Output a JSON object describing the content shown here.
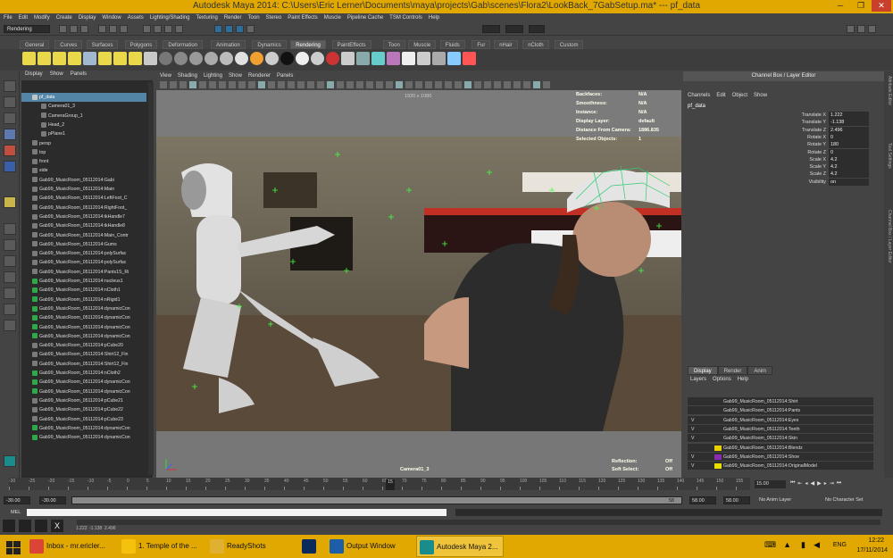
{
  "window": {
    "title": "Autodesk Maya 2014: C:\\Users\\Eric Lerner\\Documents\\maya\\projects\\Gab\\scenes\\Flora2\\LookBack_7GabSetup.ma*   ---   pf_data",
    "minimize": "─",
    "maximize": "❐",
    "close": "✕"
  },
  "menu": [
    "File",
    "Edit",
    "Modify",
    "Create",
    "Display",
    "Window",
    "Assets",
    "Lighting/Shading",
    "Texturing",
    "Render",
    "Toon",
    "Stereo",
    "Paint Effects",
    "Muscle",
    "Pipeline Cache",
    "TSM Controls",
    "Help"
  ],
  "status": {
    "menuset": "Rendering"
  },
  "shelf_tabs": [
    {
      "label": "General",
      "active": false
    },
    {
      "label": "Curves",
      "active": false
    },
    {
      "label": "Surfaces",
      "active": false
    },
    {
      "label": "Polygons",
      "active": false
    },
    {
      "label": "Deformation",
      "active": false
    },
    {
      "label": "Animation",
      "active": false
    },
    {
      "label": "Dynamics",
      "active": false
    },
    {
      "label": "Rendering",
      "active": true
    },
    {
      "label": "PaintEffects",
      "active": false
    },
    {
      "label": "Toon",
      "active": false
    },
    {
      "label": "Muscle",
      "active": false
    },
    {
      "label": "Fluids",
      "active": false
    },
    {
      "label": "Fur",
      "active": false
    },
    {
      "label": "nHair",
      "active": false
    },
    {
      "label": "nCloth",
      "active": false
    },
    {
      "label": "Custom",
      "active": false
    }
  ],
  "outliner": {
    "menu": [
      "Display",
      "Show",
      "Panels"
    ],
    "items": [
      {
        "label": "pf_data",
        "sel": true,
        "indent": 1,
        "icon": "j"
      },
      {
        "label": "Camera01_3",
        "indent": 2,
        "icon": "c"
      },
      {
        "label": "CameraGroup_1",
        "indent": 2,
        "icon": "c"
      },
      {
        "label": "Head_2",
        "indent": 2,
        "icon": "c"
      },
      {
        "label": "pPlane1",
        "indent": 2,
        "icon": "c"
      },
      {
        "label": "persp",
        "indent": 1,
        "icon": "c"
      },
      {
        "label": "top",
        "indent": 1,
        "icon": "c"
      },
      {
        "label": "front",
        "indent": 1,
        "icon": "c"
      },
      {
        "label": "side",
        "indent": 1,
        "icon": "c"
      },
      {
        "label": "Gab99_MusicRoom_0511201​4:Gabi",
        "indent": 1,
        "icon": "c"
      },
      {
        "label": "Gab99_MusicRoom_0511201​4:Main",
        "indent": 1,
        "icon": "c"
      },
      {
        "label": "Gab99_MusicRoom_0511201​4:LeftFoot_C",
        "indent": 1,
        "icon": "c"
      },
      {
        "label": "Gab99_MusicRoom_0511201​4:RightFoot_",
        "indent": 1,
        "icon": "c"
      },
      {
        "label": "Gab99_MusicRoom_0511201​4:ikHandle7",
        "indent": 1,
        "icon": "c"
      },
      {
        "label": "Gab99_MusicRoom_0511201​4:ikHandle8",
        "indent": 1,
        "icon": "c"
      },
      {
        "label": "Gab99_MusicRoom_0511201​4:Main_Contr",
        "indent": 1,
        "icon": "c"
      },
      {
        "label": "Gab99_MusicRoom_0511201​4:Gums",
        "indent": 1,
        "icon": "c"
      },
      {
        "label": "Gab99_MusicRoom_0511201​4:polySurfac",
        "indent": 1,
        "icon": "c"
      },
      {
        "label": "Gab99_MusicRoom_0511201​4:polySurfac",
        "indent": 1,
        "icon": "c"
      },
      {
        "label": "Gab99_MusicRoom_0511201​4:Pants1S_Ri",
        "indent": 1,
        "icon": "c"
      },
      {
        "label": "Gab99_MusicRoom_0511201​4:nucleus1",
        "indent": 1,
        "icon": "g"
      },
      {
        "label": "Gab99_MusicRoom_0511201​4:nCloth1",
        "indent": 1,
        "icon": "g"
      },
      {
        "label": "Gab99_MusicRoom_0511201​4:nRigid1",
        "indent": 1,
        "icon": "g"
      },
      {
        "label": "Gab99_MusicRoom_0511201​4:dynamicCon",
        "indent": 1,
        "icon": "g"
      },
      {
        "label": "Gab99_MusicRoom_0511201​4:dynamicCon",
        "indent": 1,
        "icon": "g"
      },
      {
        "label": "Gab99_MusicRoom_0511201​4:dynamicCon",
        "indent": 1,
        "icon": "g"
      },
      {
        "label": "Gab99_MusicRoom_0511201​4:dynamicCon",
        "indent": 1,
        "icon": "g"
      },
      {
        "label": "Gab99_MusicRoom_0511201​4:pCube20",
        "indent": 1,
        "icon": "c"
      },
      {
        "label": "Gab99_MusicRoom_0511201​4:Shirt12_Fin",
        "indent": 1,
        "icon": "c"
      },
      {
        "label": "Gab99_MusicRoom_0511201​4:Shirt12_Fin",
        "indent": 1,
        "icon": "c"
      },
      {
        "label": "Gab99_MusicRoom_0511201​4:nCloth2",
        "indent": 1,
        "icon": "g"
      },
      {
        "label": "Gab99_MusicRoom_0511201​4:dynamicCon",
        "indent": 1,
        "icon": "g"
      },
      {
        "label": "Gab99_MusicRoom_0511201​4:dynamicCon",
        "indent": 1,
        "icon": "g"
      },
      {
        "label": "Gab99_MusicRoom_0511201​4:pCube21",
        "indent": 1,
        "icon": "c"
      },
      {
        "label": "Gab99_MusicRoom_0511201​4:pCube22",
        "indent": 1,
        "icon": "c"
      },
      {
        "label": "Gab99_MusicRoom_0511201​4:pCube23",
        "indent": 1,
        "icon": "c"
      },
      {
        "label": "Gab99_MusicRoom_0511201​4:dynamicCon",
        "indent": 1,
        "icon": "g"
      },
      {
        "label": "Gab99_MusicRoom_0511201​4:dynamicCon",
        "indent": 1,
        "icon": "g"
      }
    ]
  },
  "viewport": {
    "menu": [
      "View",
      "Shading",
      "Lighting",
      "Show",
      "Renderer",
      "Panels"
    ],
    "resolution": "1920 x 1080",
    "hud": [
      {
        "k": "Backfaces:",
        "v": "N/A"
      },
      {
        "k": "Smoothness:",
        "v": "N/A"
      },
      {
        "k": "Instance:",
        "v": "N/A"
      },
      {
        "k": "Display Layer:",
        "v": "default"
      },
      {
        "k": "Distance From Camera:",
        "v": "1886.835"
      },
      {
        "k": "Selected Objects:",
        "v": "1"
      }
    ],
    "camera": "Camera01_3",
    "reflection_label": "Reflection:",
    "reflection": "Off",
    "softselect_label": "Soft Select:",
    "softselect": "Off"
  },
  "channelbox": {
    "title": "Channel Box / Layer Editor",
    "menu": [
      "Channels",
      "Edit",
      "Object",
      "Show"
    ],
    "object": "pf_data",
    "channels": [
      {
        "n": "Translate X",
        "v": "1.222"
      },
      {
        "n": "Translate Y",
        "v": "-1.138"
      },
      {
        "n": "Translate Z",
        "v": "2.496"
      },
      {
        "n": "Rotate X",
        "v": "0"
      },
      {
        "n": "Rotate Y",
        "v": "180"
      },
      {
        "n": "Rotate Z",
        "v": "0"
      },
      {
        "n": "Scale X",
        "v": "4.2"
      },
      {
        "n": "Scale Y",
        "v": "4.2"
      },
      {
        "n": "Scale Z",
        "v": "4.2"
      },
      {
        "n": "Visibility",
        "v": "on"
      }
    ]
  },
  "layers": {
    "tabs": [
      "Display",
      "Render",
      "Anim"
    ],
    "active": "Display",
    "menu": [
      "Layers",
      "Options",
      "Help"
    ],
    "rows": [
      {
        "vis": "",
        "color": "",
        "name": "Gab99_MusicRoom_0511201​4:Shirt"
      },
      {
        "vis": "",
        "color": "",
        "name": "Gab99_MusicRoom_0511201​4:Pants"
      },
      {
        "vis": "V",
        "color": "",
        "name": "Gab99_MusicRoom_0511201​4:Eyes"
      },
      {
        "vis": "V",
        "color": "",
        "name": "Gab99_MusicRoom_0511201​4:Teeth"
      },
      {
        "vis": "V",
        "color": "",
        "name": "Gab99_MusicRoom_0511201​4:Skin"
      },
      {
        "vis": "",
        "color": "#e8d000",
        "name": "Gab99_MusicRoom_0511201​4:Blendz"
      },
      {
        "vis": "V",
        "color": "#8b2bb0",
        "name": "Gab99_MusicRoom_0511201​4:Shoe"
      },
      {
        "vis": "V",
        "color": "#e8e000",
        "name": "Gab99_MusicRoom_0511201​4:OriginalModel"
      }
    ]
  },
  "sidetabs": [
    "Attribute Editor",
    "Tool Settings",
    "Channel Box / Layer Editor"
  ],
  "timeline": {
    "ticks": [
      "-30",
      "-25",
      "-20",
      "-15",
      "-10",
      "-5",
      "0",
      "5",
      "10",
      "15",
      "20",
      "25",
      "30",
      "35",
      "40",
      "45",
      "50",
      "55",
      "60",
      "65",
      "70",
      "75",
      "80",
      "85",
      "90",
      "95",
      "100",
      "105",
      "110",
      "115",
      "120",
      "125",
      "130",
      "135",
      "140",
      "145",
      "150",
      "155"
    ],
    "current": "15",
    "current_frame": "15.00"
  },
  "range": {
    "start": "-30.00",
    "start2": "-30.00",
    "mid": "15",
    "end1": "58",
    "end2": "58.00",
    "end3": "58.00",
    "anim_layer": "No Anim Layer",
    "char_set": "No Character Set"
  },
  "cmdline": {
    "label": "MEL"
  },
  "helpline": {
    "tx": "1.222",
    "ty": "-1.138",
    "tz": "2.496"
  },
  "taskbar": {
    "items": [
      {
        "label": "Inbox - mr.ericler...",
        "color": "#db4437"
      },
      {
        "label": "1. Temple of the ...",
        "color": "#f4c20d"
      },
      {
        "label": "ReadyShots",
        "color": "#e0b030"
      },
      {
        "label": "",
        "color": "#0a2a5c"
      },
      {
        "label": "Output Window",
        "color": "#1d5ea8"
      },
      {
        "label": "Autodesk Maya 2...",
        "color": "#1b8c8c"
      }
    ],
    "lang": "ENG",
    "time": "12:22",
    "date": "17/11/2014"
  }
}
